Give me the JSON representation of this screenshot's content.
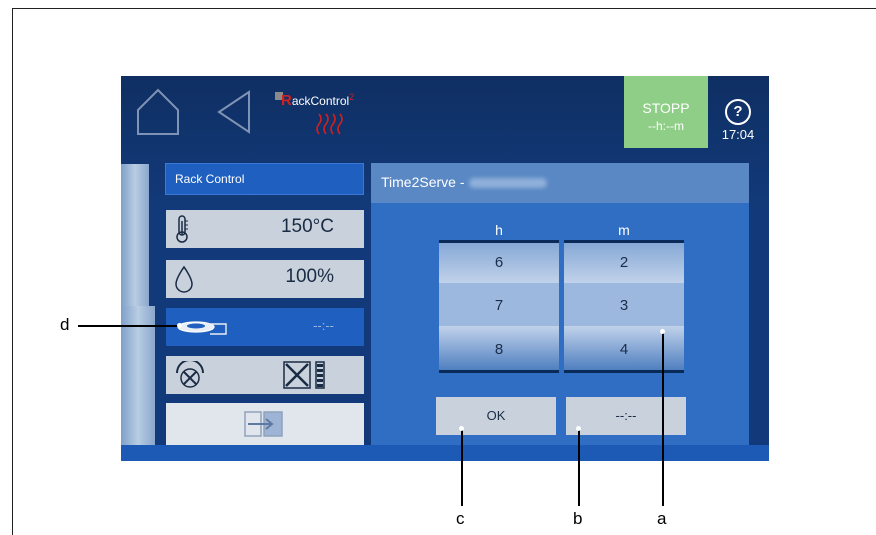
{
  "header": {
    "logo_brand": "RackControl",
    "logo_sup": "2",
    "stopp_label": "STOPP",
    "stopp_time": "--h:--m",
    "help_symbol": "?",
    "clock": "17:04"
  },
  "left_panel": {
    "title": "Rack Control",
    "temperature": "150°C",
    "humidity": "100%",
    "time2serve_value": "--:--"
  },
  "time2serve": {
    "title": "Time2Serve -",
    "col_hours": "h",
    "col_minutes": "m",
    "hours": [
      "6",
      "7",
      "8"
    ],
    "minutes": [
      "2",
      "3",
      "4"
    ],
    "ok_label": "OK",
    "clear_label": "--:--"
  },
  "callouts": {
    "a": "a",
    "b": "b",
    "c": "c",
    "d": "d"
  },
  "colors": {
    "screen_bg": "#123a7a",
    "accent_blue": "#1e5fc0",
    "stopp_green": "#8fce87",
    "tile_grey": "#c9d2dc",
    "logo_red": "#d1201f"
  },
  "icons": [
    "home-icon",
    "back-icon",
    "thermometer-icon",
    "droplet-icon",
    "hand-plate-icon",
    "fan-gauge-icon",
    "fan-grid-icon",
    "exit-icon",
    "help-icon"
  ]
}
